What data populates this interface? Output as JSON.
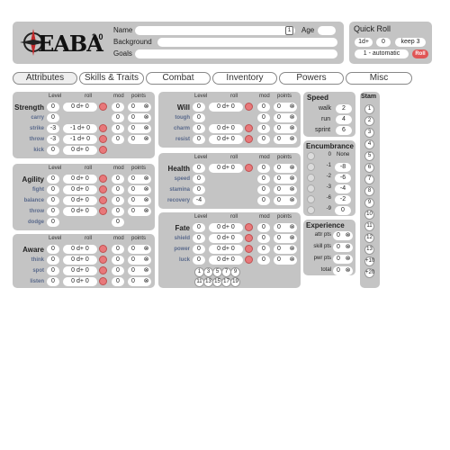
{
  "logo": {
    "text": "EABA",
    "version": "2.0"
  },
  "header": {
    "name_label": "Name",
    "age_label": "Age",
    "background_label": "Background",
    "goals_label": "Goals",
    "name_icon": "1"
  },
  "quick": {
    "title": "Quick Roll",
    "dice": "1d+",
    "mod": "0",
    "keep": "keep 3",
    "mode": "1 - automatic",
    "roll_btn": "Roll"
  },
  "tabs": [
    "Attributes",
    "Skills & Traits",
    "Combat",
    "Inventory",
    "Powers",
    "Misc"
  ],
  "cols": {
    "level": "Level",
    "roll": "roll",
    "mod": "mod",
    "points": "points"
  },
  "strength": {
    "name": "Strength",
    "level": "0",
    "roll": "0 d+ 0",
    "mod": "0",
    "points": "0",
    "skills": [
      {
        "name": "carry",
        "level": "0",
        "roll": "",
        "mod": "0",
        "points": "0"
      },
      {
        "name": "strike",
        "level": "-3",
        "roll": "-1 d+ 0",
        "mod": "0",
        "points": "0"
      },
      {
        "name": "throw",
        "level": "-3",
        "roll": "-1 d+ 0",
        "mod": "0",
        "points": "0"
      },
      {
        "name": "kick",
        "level": "0",
        "roll": "0 d+ 0",
        "mod": "",
        "points": ""
      }
    ]
  },
  "agility": {
    "name": "Agility",
    "level": "0",
    "roll": "0 d+ 0",
    "mod": "0",
    "points": "0",
    "skills": [
      {
        "name": "fight",
        "level": "0",
        "roll": "0 d+ 0",
        "mod": "0",
        "points": "0"
      },
      {
        "name": "balance",
        "level": "0",
        "roll": "0 d+ 0",
        "mod": "0",
        "points": "0"
      },
      {
        "name": "throw",
        "level": "0",
        "roll": "0 d+ 0",
        "mod": "0",
        "points": "0"
      },
      {
        "name": "dodge",
        "level": "0",
        "roll": "",
        "mod": "0",
        "points": ""
      }
    ]
  },
  "aware": {
    "name": "Aware",
    "level": "0",
    "roll": "0 d+ 0",
    "mod": "0",
    "points": "0",
    "skills": [
      {
        "name": "think",
        "level": "0",
        "roll": "0 d+ 0",
        "mod": "0",
        "points": "0"
      },
      {
        "name": "spot",
        "level": "0",
        "roll": "0 d+ 0",
        "mod": "0",
        "points": "0"
      },
      {
        "name": "listen",
        "level": "0",
        "roll": "0 d+ 0",
        "mod": "0",
        "points": "0"
      }
    ]
  },
  "will": {
    "name": "Will",
    "level": "0",
    "roll": "0 d+ 0",
    "mod": "0",
    "points": "0",
    "skills": [
      {
        "name": "tough",
        "level": "0",
        "roll": "",
        "mod": "0",
        "points": "0"
      },
      {
        "name": "charm",
        "level": "0",
        "roll": "0 d+ 0",
        "mod": "0",
        "points": "0"
      },
      {
        "name": "resist",
        "level": "0",
        "roll": "0 d+ 0",
        "mod": "0",
        "points": "0"
      }
    ]
  },
  "health": {
    "name": "Health",
    "level": "0",
    "roll": "0 d+ 0",
    "mod": "0",
    "points": "0",
    "skills": [
      {
        "name": "speed",
        "level": "0",
        "roll": "",
        "mod": "0",
        "points": "0"
      },
      {
        "name": "stamina",
        "level": "0",
        "roll": "",
        "mod": "0",
        "points": "0"
      },
      {
        "name": "recovery",
        "level": "-4",
        "roll": "",
        "mod": "0",
        "points": "0"
      }
    ]
  },
  "fate": {
    "name": "Fate",
    "level": "0",
    "roll": "0 d+ 0",
    "mod": "0",
    "points": "0",
    "skills": [
      {
        "name": "shield",
        "level": "0",
        "roll": "0 d+ 0",
        "mod": "0",
        "points": "0"
      },
      {
        "name": "power",
        "level": "0",
        "roll": "0 d+ 0",
        "mod": "0",
        "points": "0"
      },
      {
        "name": "luck",
        "level": "0",
        "roll": "0 d+ 0",
        "mod": "0",
        "points": "0"
      }
    ],
    "circles1": [
      "1",
      "3",
      "5",
      "7",
      "9"
    ],
    "circles2": [
      "11",
      "13",
      "15",
      "17",
      "19"
    ]
  },
  "speed": {
    "title": "Speed",
    "rows": [
      {
        "name": "walk",
        "value": "2"
      },
      {
        "name": "run",
        "value": "4"
      },
      {
        "name": "sprint",
        "value": "6"
      }
    ]
  },
  "encumbrance": {
    "title": "Encumbrance",
    "rows": [
      {
        "mod": "0",
        "label": "None"
      },
      {
        "mod": "-1",
        "label": "-8"
      },
      {
        "mod": "-2",
        "label": "-6"
      },
      {
        "mod": "-3",
        "label": "-4"
      },
      {
        "mod": "-6",
        "label": "-2"
      },
      {
        "mod": "-9",
        "label": "0"
      }
    ]
  },
  "experience": {
    "title": "Experience",
    "rows": [
      {
        "name": "attr pts",
        "value": "0"
      },
      {
        "name": "skill pts",
        "value": "0"
      },
      {
        "name": "pwr pts",
        "value": "0"
      },
      {
        "name": "total",
        "value": "0"
      }
    ]
  },
  "stam": {
    "title": "Stam",
    "values": [
      "1",
      "2",
      "3",
      "4",
      "5",
      "6",
      "7",
      "8",
      "9",
      "10",
      "11",
      "12",
      "13",
      "+10",
      "+20"
    ]
  },
  "colors": {
    "panel": "#c4c4c4",
    "accent": "#e8787a",
    "label": "#5a6a8c"
  }
}
